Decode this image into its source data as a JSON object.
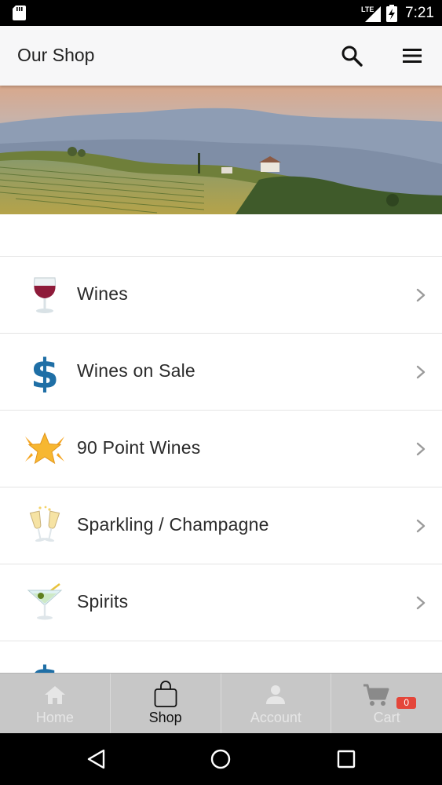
{
  "status_bar": {
    "network": "LTE",
    "time": "7:21"
  },
  "app_bar": {
    "title": "Our Shop",
    "icons": [
      "search-icon",
      "menu-icon"
    ]
  },
  "hero": {
    "image": "vineyard-landscape"
  },
  "categories": [
    {
      "label": "Wines",
      "icon": "wine-glass-icon"
    },
    {
      "label": "Wines on Sale",
      "icon": "dollar-sign-icon"
    },
    {
      "label": "90 Point Wines",
      "icon": "star-burst-icon"
    },
    {
      "label": "Sparkling / Champagne",
      "icon": "champagne-glasses-icon"
    },
    {
      "label": "Spirits",
      "icon": "cocktail-glass-icon"
    }
  ],
  "bottom_nav": {
    "tabs": [
      {
        "label": "Home",
        "icon": "home-icon",
        "active": false
      },
      {
        "label": "Shop",
        "icon": "shopping-bag-icon",
        "active": true
      },
      {
        "label": "Account",
        "icon": "person-icon",
        "active": false
      },
      {
        "label": "Cart",
        "icon": "cart-icon",
        "active": false,
        "badge": "0"
      }
    ]
  },
  "colors": {
    "app_bar_bg": "#f7f7f8",
    "dollar_blue": "#1f6fa6",
    "star_orange": "#f5a623",
    "wine_red": "#8e1b3a",
    "badge_red": "#e4463a",
    "bottom_nav_bg": "#c7c7c7"
  }
}
